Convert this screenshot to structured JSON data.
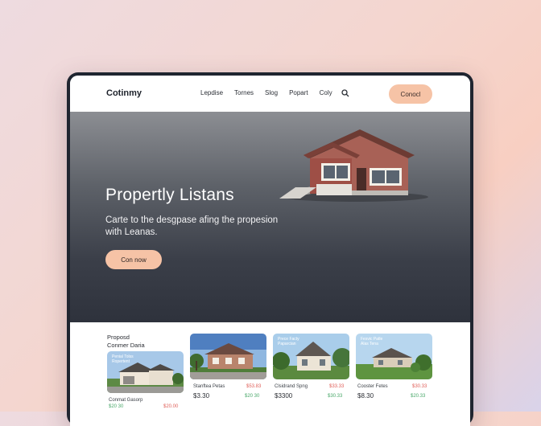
{
  "nav": {
    "logo": "Cotinmy",
    "items": [
      "Lepdise",
      "Tornes",
      "Slog",
      "Popart",
      "Coly"
    ],
    "cta": "Conocl"
  },
  "hero": {
    "title": "Propertly Listans",
    "subtitle": "Carte to the desgpase afing the propesion with Leanas.",
    "button": "Con now"
  },
  "listings": {
    "heading_line1": "Proposd",
    "heading_line2": "Conmer Daria",
    "cards": [
      {
        "photo_title": "Penial Tolss\nRopertent",
        "name": "Conmat Gasorp",
        "old_price": "$20.00",
        "price": "",
        "new_price": "$20 30"
      },
      {
        "photo_title": "",
        "name": "Stanftea Petas",
        "old_price": "$53.83",
        "price": "$3.30",
        "new_price": "$20 30"
      },
      {
        "photo_title": "Prece Facty\nPaparcian",
        "name": "Clsidrand Spng",
        "old_price": "$33.33",
        "price": "$3300",
        "new_price": "$30.33"
      },
      {
        "photo_title": "Fesvic Patle\nAlas Tena",
        "name": "Cooster Fetes",
        "old_price": "$30.33",
        "price": "$8.30",
        "new_price": "$20.33"
      }
    ]
  },
  "colors": {
    "accent": "#f6c3a6",
    "hero_dark": "#2e323c",
    "price_red": "#e0605a",
    "price_green": "#4aa86a"
  }
}
